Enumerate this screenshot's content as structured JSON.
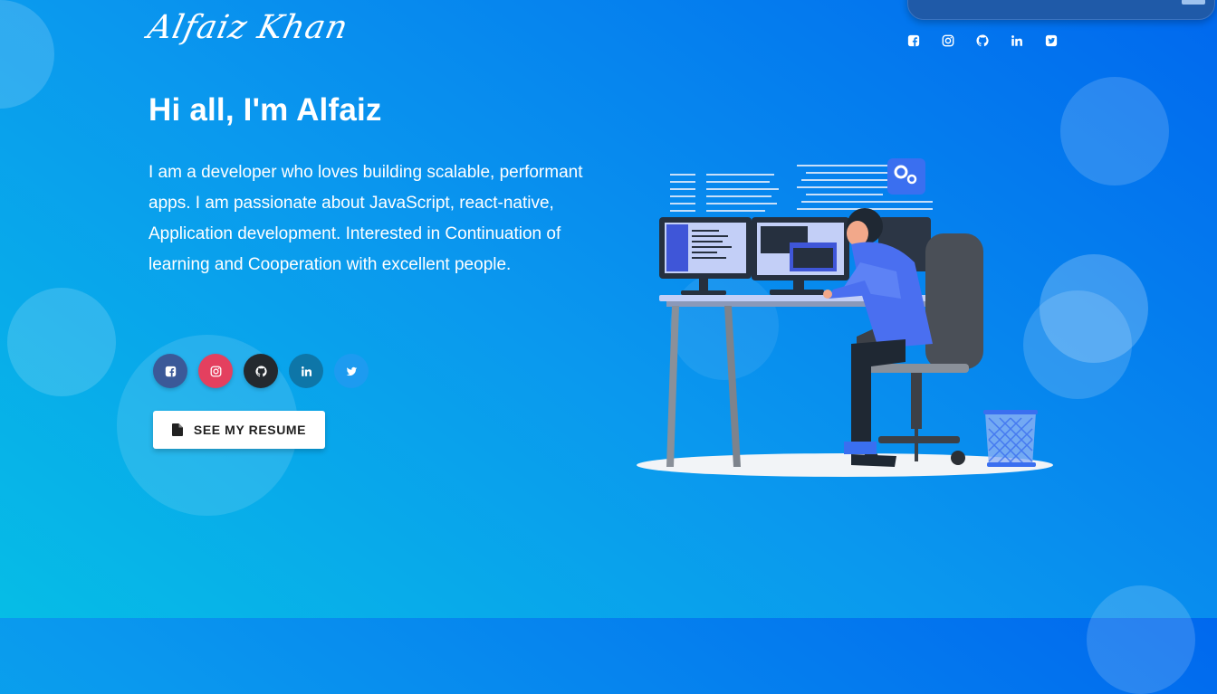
{
  "brand": {
    "logo_text": "Alfaiz Khan"
  },
  "header_social": [
    {
      "name": "facebook"
    },
    {
      "name": "instagram"
    },
    {
      "name": "github"
    },
    {
      "name": "linkedin"
    },
    {
      "name": "twitter"
    }
  ],
  "hero": {
    "greeting": "Hi all, I'm Alfaiz",
    "bio": "I am a developer who loves building scalable, performant apps. I am passionate about JavaScript, react-native, Application development. Interested in Continuation of learning and Cooperation with excellent people.",
    "resume_label": "SEE MY RESUME"
  },
  "social_buttons": [
    {
      "name": "facebook",
      "color": "#3b5998"
    },
    {
      "name": "instagram",
      "color": "#e4405f"
    },
    {
      "name": "github",
      "color": "#24292e"
    },
    {
      "name": "linkedin",
      "color": "#0e76a8"
    },
    {
      "name": "twitter",
      "color": "#1da1f2"
    }
  ]
}
